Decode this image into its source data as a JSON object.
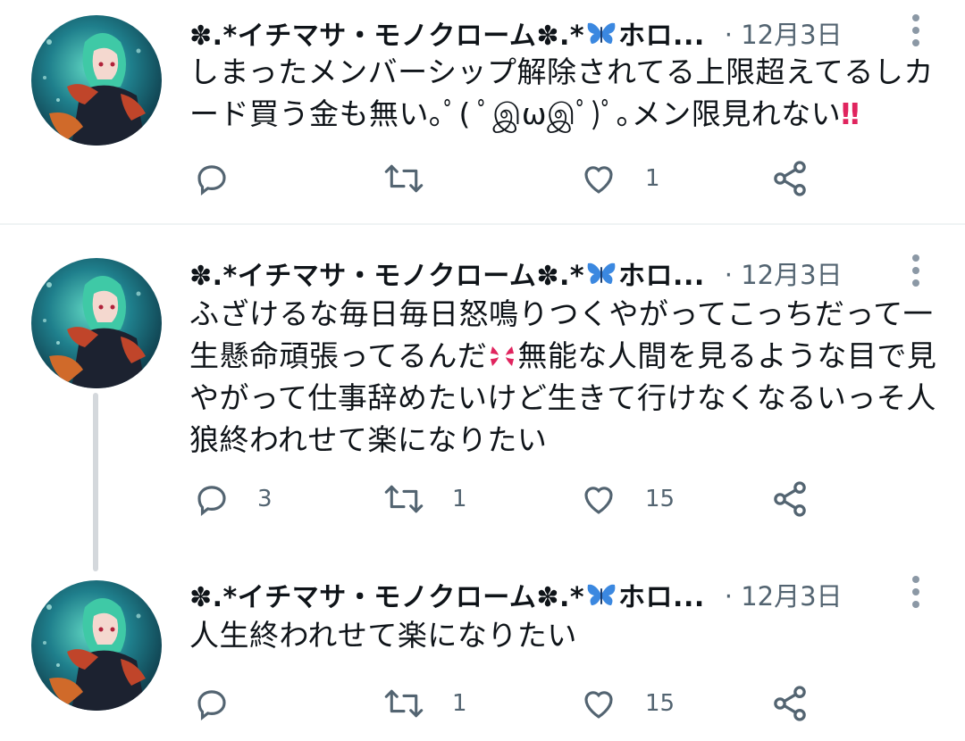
{
  "colors": {
    "text_primary": "#0f1419",
    "text_secondary": "#536471",
    "icon": "#536471",
    "thread_line": "#d4d8dc",
    "divider": "#eff3f4"
  },
  "tweets": [
    {
      "display_name_prefix": "✽.*イチマサ・モノクローム✽.*",
      "display_name_suffix": "ホロ...",
      "separator": "·",
      "date": "12月3日",
      "text": "しまったメンバーシップ解除されてる上限超えてるしカード買う金も無い｡ﾟ( ﾟஇωஇﾟ)ﾟ｡メン限見れない",
      "emoji_trailing": "‼",
      "reply_count": "",
      "retweet_count": "",
      "like_count": "1"
    },
    {
      "display_name_prefix": "✽.*イチマサ・モノクローム✽.*",
      "display_name_suffix": "ホロ...",
      "separator": "·",
      "date": "12月3日",
      "text_part1": "ふざけるな毎日毎日怒鳴りつくやがってこっちだって一生懸命頑張ってるんだ",
      "text_part2": "無能な人間を見るような目で見やがって仕事辞めたいけど生きて行けなくなるいっそ人狼終われせて楽になりたい",
      "reply_count": "3",
      "retweet_count": "1",
      "like_count": "15"
    },
    {
      "display_name_prefix": "✽.*イチマサ・モノクローム✽.*",
      "display_name_suffix": "ホロ...",
      "separator": "·",
      "date": "12月3日",
      "text": "人生終われせて楽になりたい",
      "reply_count": "",
      "retweet_count": "1",
      "like_count": "15"
    }
  ],
  "icons": [
    "reply-icon",
    "retweet-icon",
    "like-icon",
    "share-icon",
    "more-icon",
    "butterfly-emoji-icon",
    "anger-emoji-icon"
  ]
}
